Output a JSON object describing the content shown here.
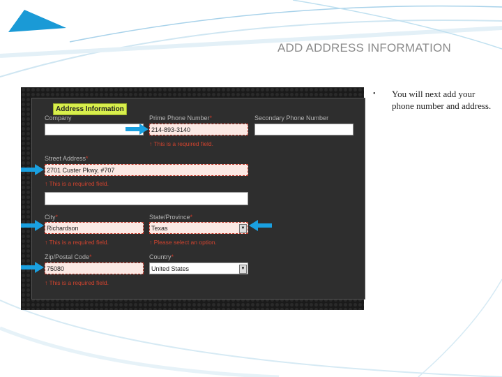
{
  "slide": {
    "title": "ADD ADDRESS INFORMATION",
    "bullet": "You will next add your phone number and address."
  },
  "form": {
    "header": "Address Information",
    "company": {
      "label": "Company",
      "value": ""
    },
    "prime_phone": {
      "label": "Prime Phone Number",
      "value": "214-893-3140",
      "error": "This is a required field."
    },
    "secondary_phone": {
      "label": "Secondary Phone Number",
      "value": ""
    },
    "street": {
      "label": "Street Address",
      "value": "2701 Custer Pkwy, #707",
      "error": "This is a required field."
    },
    "street2": {
      "value": ""
    },
    "city": {
      "label": "City",
      "value": "Richardson",
      "error": "This is a required field."
    },
    "state": {
      "label": "State/Province",
      "value": "Texas",
      "error": "Please select an option."
    },
    "zip": {
      "label": "Zip/Postal Code",
      "value": "75080",
      "error": "This is a required field."
    },
    "country": {
      "label": "Country",
      "value": "United States"
    },
    "required_mark": "*"
  },
  "colors": {
    "accent": "#1aa0e0",
    "header": "#d8ef4c",
    "error": "#d0432e"
  }
}
